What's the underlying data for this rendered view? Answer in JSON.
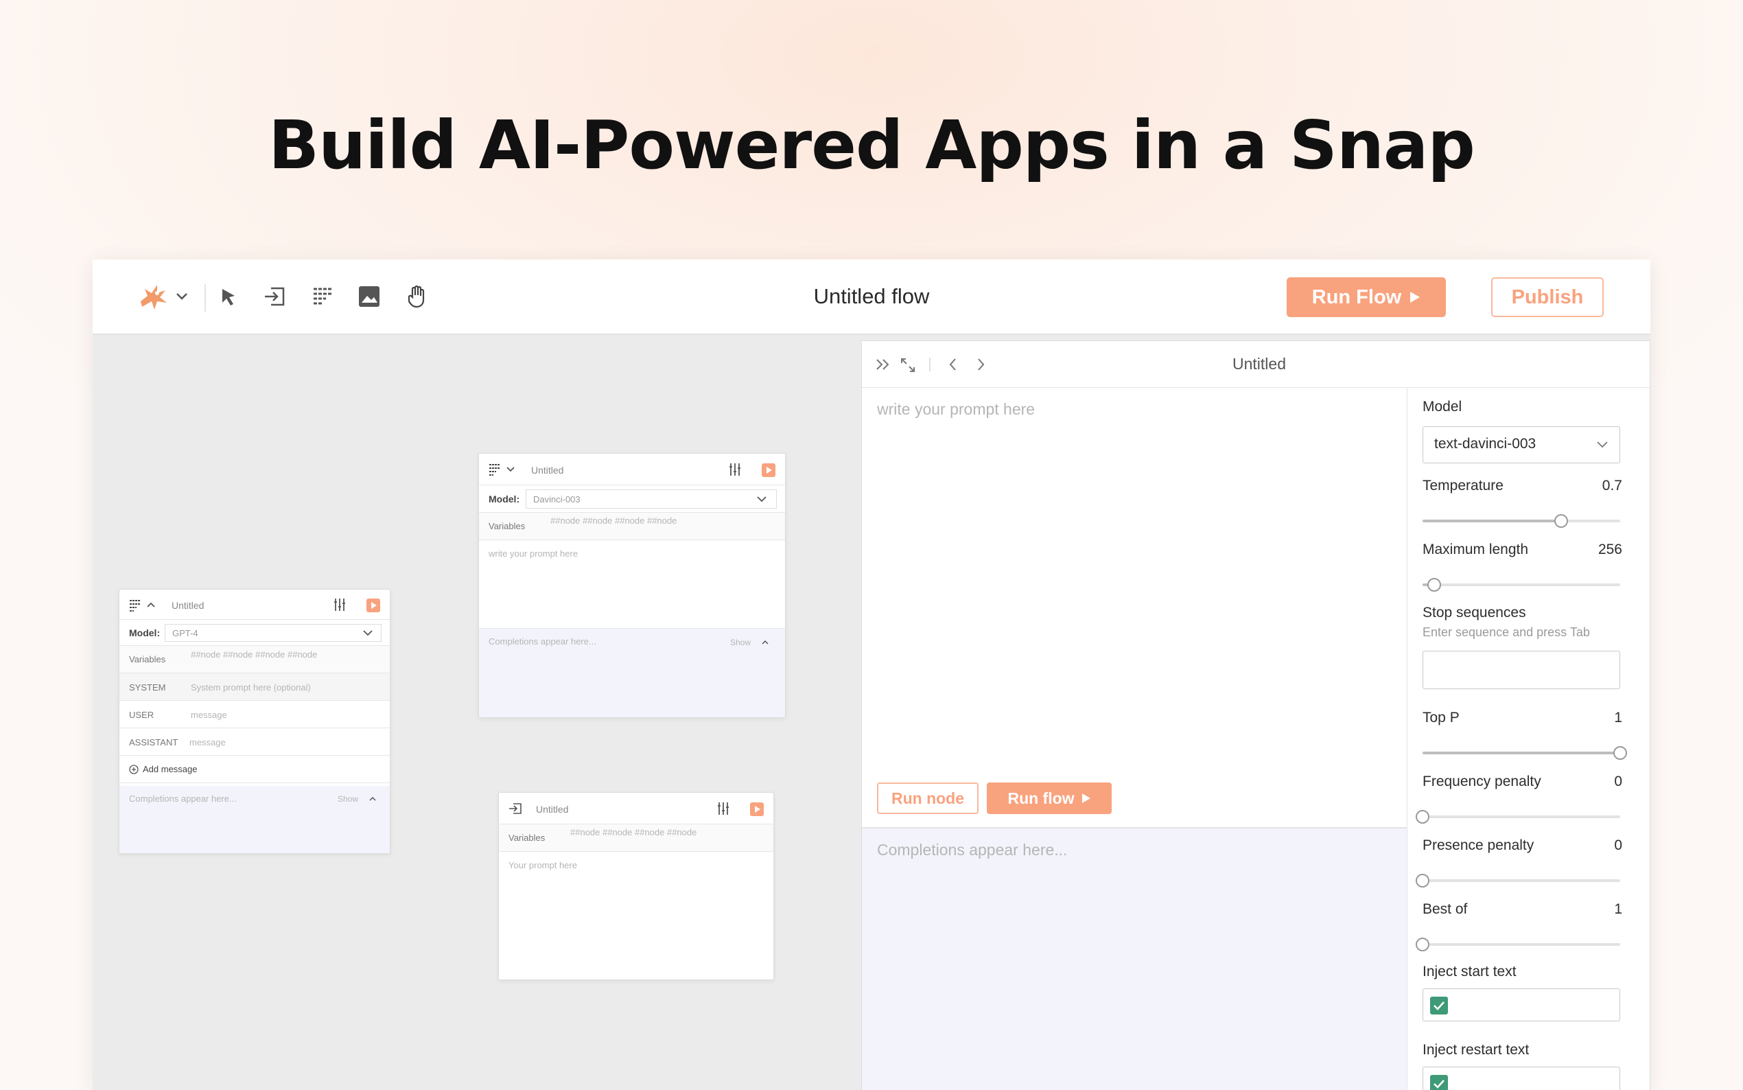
{
  "hero": {
    "title": "Build AI-Powered Apps in a Snap"
  },
  "toolbar": {
    "flow_title": "Untitled flow",
    "run_flow_label": "Run Flow",
    "publish_label": "Publish"
  },
  "node1": {
    "title": "Untitled",
    "model_label": "Model:",
    "model_value": "GPT-4",
    "variables_label": "Variables",
    "variables_value": "##node ##node ##node ##node",
    "system_label": "SYSTEM",
    "system_placeholder": "System prompt here (optional)",
    "user_label": "USER",
    "user_placeholder": "message",
    "assistant_label": "ASSISTANT",
    "assistant_placeholder": "message",
    "add_message_label": "Add message",
    "completions_placeholder": "Completions appear here...",
    "show_label": "Show"
  },
  "node2": {
    "title": "Untitled",
    "model_label": "Model:",
    "model_value": "Davinci-003",
    "variables_label": "Variables",
    "variables_value": "##node ##node ##node ##node",
    "prompt_placeholder": "write your prompt here",
    "completions_placeholder": "Completions appear here...",
    "show_label": "Show"
  },
  "node3": {
    "title": "Untitled",
    "variables_label": "Variables",
    "variables_value": "##node ##node ##node ##node",
    "prompt_placeholder": "Your prompt here"
  },
  "panel": {
    "title": "Untitled",
    "prompt_placeholder": "write your prompt here",
    "run_node_label": "Run node",
    "run_flow_label": "Run flow",
    "completions_placeholder": "Completions appear here..."
  },
  "settings": {
    "model_label": "Model",
    "model_value": "text-davinci-003",
    "temperature_label": "Temperature",
    "temperature_value": "0.7",
    "temperature_fraction": 0.7,
    "max_length_label": "Maximum length",
    "max_length_value": "256",
    "max_length_fraction": 0.06,
    "stop_sequences_label": "Stop sequences",
    "stop_sequences_hint": "Enter sequence and press Tab",
    "top_p_label": "Top P",
    "top_p_value": "1",
    "top_p_fraction": 1.0,
    "frequency_penalty_label": "Frequency penalty",
    "frequency_penalty_value": "0",
    "frequency_penalty_fraction": 0.0,
    "presence_penalty_label": "Presence penalty",
    "presence_penalty_value": "0",
    "presence_penalty_fraction": 0.0,
    "best_of_label": "Best of",
    "best_of_value": "1",
    "best_of_fraction": 0.0,
    "inject_start_label": "Inject start text",
    "inject_start_checked": true,
    "inject_restart_label": "Inject restart text",
    "inject_restart_checked": true
  },
  "colors": {
    "accent": "#f9a27e",
    "accent_border": "#f9b89b",
    "check": "#3f9a78",
    "completion_bg": "#f3f4fb"
  },
  "icons": [
    "logo-icon",
    "chevron-down-icon",
    "pointer-icon",
    "input-node-icon",
    "prompt-node-icon",
    "image-icon",
    "hand-icon",
    "sliders-icon",
    "play-icon",
    "collapse-icon",
    "expand-icon",
    "chevron-left-icon",
    "chevron-right-icon",
    "add-circle-icon",
    "check-icon"
  ]
}
